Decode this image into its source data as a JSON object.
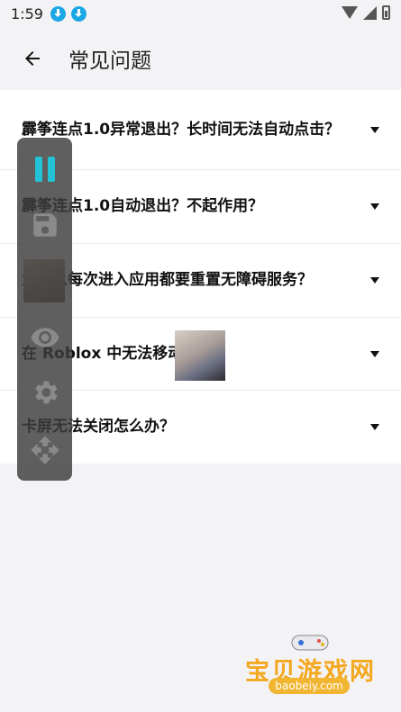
{
  "status_bar": {
    "time": "1:59"
  },
  "app_bar": {
    "title": "常见问题"
  },
  "faq": [
    {
      "question": "霹筝连点1.0异常退出？长时间无法自动点击？"
    },
    {
      "question": "霹筝连点1.0自动退出？不起作用？"
    },
    {
      "question": "为什么每次进入应用都要重置无障碍服务？"
    },
    {
      "question": "在 Roblox 中无法移动视角。"
    },
    {
      "question": "卡屏无法关闭怎么办？"
    }
  ],
  "floating_panel": {
    "icons": [
      "pause-icon",
      "save-icon",
      "eye-icon",
      "gear-icon",
      "move-icon"
    ],
    "accent_color": "#22c3d6"
  },
  "watermark": {
    "text": "宝贝游戏网",
    "url": "baobeiy.com"
  }
}
